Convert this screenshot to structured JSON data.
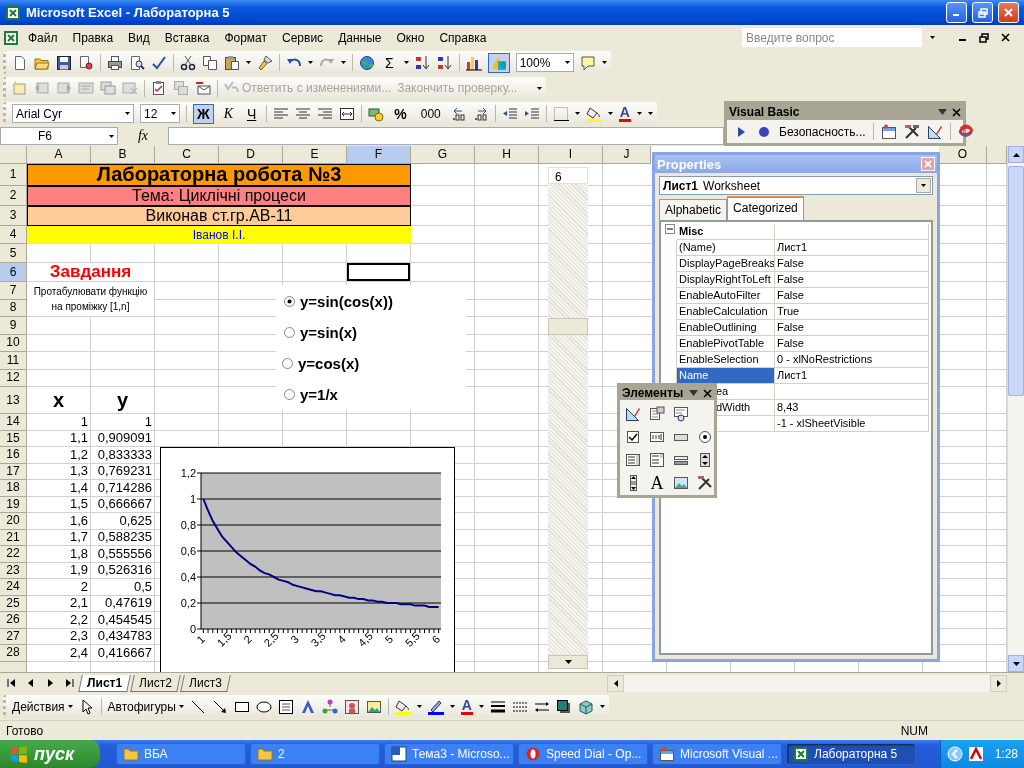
{
  "window": {
    "title": "Microsoft Excel - Лабораторна 5"
  },
  "menu": [
    "Файл",
    "Правка",
    "Вид",
    "Вставка",
    "Формат",
    "Сервис",
    "Данные",
    "Окно",
    "Справка"
  ],
  "help_box": {
    "placeholder": "Введите вопрос"
  },
  "standard_toolbar": {
    "sum_glyph": "Σ",
    "zoom": "100%",
    "drawing_on": true
  },
  "review_toolbar": {
    "actions": [
      {
        "label": "Ответить с изменениями...",
        "disabled": true
      },
      {
        "label": "Закончить проверку...",
        "disabled": true
      }
    ]
  },
  "format_toolbar": {
    "font": "Arial Cyr",
    "size": "12",
    "styles": [
      {
        "label": "Ж",
        "selected": true
      },
      {
        "label": "К",
        "selected": false
      },
      {
        "label": "Ч",
        "selected": false
      }
    ],
    "percent": "%",
    "thousands": "000",
    "font_color_glyph": "A"
  },
  "visual_basic_toolbar": {
    "title": "Visual Basic",
    "security": "Безопасность..."
  },
  "formula_bar": {
    "name_box": "F6",
    "fx": "fx"
  },
  "sheet": {
    "columns": [
      {
        "label": "A",
        "selected": false
      },
      {
        "label": "B",
        "selected": false
      },
      {
        "label": "C",
        "selected": false
      },
      {
        "label": "D",
        "selected": false
      },
      {
        "label": "E",
        "selected": false
      },
      {
        "label": "F",
        "selected": true
      },
      {
        "label": "G",
        "selected": false
      },
      {
        "label": "H",
        "selected": false
      },
      {
        "label": "I",
        "selected": false
      },
      {
        "label": "J",
        "selected": false
      },
      {
        "label": "O",
        "selected": false
      }
    ],
    "rows": [
      {
        "label": "1",
        "selected": false,
        "kind": "title",
        "cells": [
          "Лабораторна робота №3"
        ]
      },
      {
        "label": "2",
        "selected": false,
        "kind": "topic",
        "cells": [
          "Тема: Циклічні процеси"
        ]
      },
      {
        "label": "3",
        "selected": false,
        "kind": "author",
        "cells": [
          "Виконав ст.гр.АВ-11"
        ]
      },
      {
        "label": "4",
        "selected": false,
        "kind": "name",
        "cells": [
          "Іванов І.І."
        ]
      },
      {
        "label": "5",
        "selected": false,
        "kind": "blank"
      },
      {
        "label": "6",
        "selected": true,
        "kind": "task",
        "cells": [
          "Завдання"
        ]
      },
      {
        "label": "7",
        "selected": false,
        "kind": "note",
        "cells": [
          "Протабулювати функцію на проміжку [1,n]"
        ]
      },
      {
        "label": "8",
        "selected": false,
        "kind": "blank"
      },
      {
        "label": "9",
        "selected": false,
        "kind": "blank"
      },
      {
        "label": "10",
        "selected": false,
        "kind": "blank"
      },
      {
        "label": "11",
        "selected": false,
        "kind": "blank"
      },
      {
        "label": "12",
        "selected": false,
        "kind": "blank"
      },
      {
        "label": "13",
        "selected": false,
        "kind": "head",
        "cells": [
          "x",
          "y"
        ]
      },
      {
        "label": "14",
        "selected": false,
        "kind": "data",
        "cells": [
          "1",
          "1"
        ]
      },
      {
        "label": "15",
        "selected": false,
        "kind": "data",
        "cells": [
          "1,1",
          "0,909091"
        ]
      },
      {
        "label": "16",
        "selected": false,
        "kind": "data",
        "cells": [
          "1,2",
          "0,833333"
        ]
      },
      {
        "label": "17",
        "selected": false,
        "kind": "data",
        "cells": [
          "1,3",
          "0,769231"
        ]
      },
      {
        "label": "18",
        "selected": false,
        "kind": "data",
        "cells": [
          "1,4",
          "0,714286"
        ]
      },
      {
        "label": "19",
        "selected": false,
        "kind": "data",
        "cells": [
          "1,5",
          "0,666667"
        ]
      },
      {
        "label": "20",
        "selected": false,
        "kind": "data",
        "cells": [
          "1,6",
          "0,625"
        ]
      },
      {
        "label": "21",
        "selected": false,
        "kind": "data",
        "cells": [
          "1,7",
          "0,588235"
        ]
      },
      {
        "label": "22",
        "selected": false,
        "kind": "data",
        "cells": [
          "1,8",
          "0,555556"
        ]
      },
      {
        "label": "23",
        "selected": false,
        "kind": "data",
        "cells": [
          "1,9",
          "0,526316"
        ]
      },
      {
        "label": "24",
        "selected": false,
        "kind": "data",
        "cells": [
          "2",
          "0,5"
        ]
      },
      {
        "label": "25",
        "selected": false,
        "kind": "data",
        "cells": [
          "2,1",
          "0,47619"
        ]
      },
      {
        "label": "26",
        "selected": false,
        "kind": "data",
        "cells": [
          "2,2",
          "0,454545"
        ]
      },
      {
        "label": "27",
        "selected": false,
        "kind": "data",
        "cells": [
          "2,3",
          "0,434783"
        ]
      },
      {
        "label": "28",
        "selected": false,
        "kind": "data",
        "cells": [
          "2,4",
          "0,416667"
        ]
      }
    ],
    "options": [
      {
        "label": "y=sin(cos(x))",
        "selected": true
      },
      {
        "label": "y=sin(x)",
        "selected": false
      },
      {
        "label": "y=cos(x)",
        "selected": false
      },
      {
        "label": "y=1/x",
        "selected": false
      }
    ],
    "scroll_control": {
      "value": "6"
    },
    "chart": {
      "chart_data": {
        "type": "line",
        "x": [
          1,
          1.1,
          1.2,
          1.3,
          1.4,
          1.5,
          1.6,
          1.7,
          1.8,
          1.9,
          2,
          2.1,
          2.2,
          2.3,
          2.4,
          2.5,
          2.6,
          2.7,
          2.8,
          2.9,
          3,
          3.1,
          3.2,
          3.3,
          3.4,
          3.5,
          3.6,
          3.7,
          3.8,
          3.9,
          4,
          4.1,
          4.2,
          4.3,
          4.4,
          4.5,
          4.6,
          4.7,
          4.8,
          4.9,
          5,
          5.1,
          5.2,
          5.3,
          5.4,
          5.5,
          5.6,
          5.7,
          5.8,
          5.9,
          6
        ],
        "series": [
          {
            "color": "#000080",
            "values": [
              1,
              0.91,
              0.83,
              0.77,
              0.71,
              0.67,
              0.63,
              0.59,
              0.56,
              0.53,
              0.5,
              0.48,
              0.45,
              0.43,
              0.42,
              0.4,
              0.38,
              0.37,
              0.36,
              0.34,
              0.33,
              0.32,
              0.31,
              0.3,
              0.29,
              0.29,
              0.28,
              0.27,
              0.26,
              0.26,
              0.25,
              0.24,
              0.24,
              0.23,
              0.23,
              0.22,
              0.22,
              0.21,
              0.21,
              0.2,
              0.2,
              0.2,
              0.19,
              0.19,
              0.19,
              0.18,
              0.18,
              0.18,
              0.17,
              0.17,
              0.17
            ]
          }
        ],
        "xlim": [
          0.95,
          6.05
        ],
        "ylim": [
          0,
          1.2
        ],
        "grid": true,
        "yticks": [
          {
            "value": 0,
            "label": "0"
          },
          {
            "value": 0.2,
            "label": "0,2"
          },
          {
            "value": 0.4,
            "label": "0,4"
          },
          {
            "value": 0.6,
            "label": "0,6"
          },
          {
            "value": 0.8,
            "label": "0,8"
          },
          {
            "value": 1,
            "label": "1"
          },
          {
            "value": 1.2,
            "label": "1,2"
          }
        ],
        "xticks": [
          {
            "value": 1,
            "label": "1"
          },
          {
            "value": 1.5,
            "label": "1,5"
          },
          {
            "value": 2,
            "label": "2"
          },
          {
            "value": 2.5,
            "label": "2,5"
          },
          {
            "value": 3,
            "label": "3"
          },
          {
            "value": 3.5,
            "label": "3,5"
          },
          {
            "value": 4,
            "label": "4"
          },
          {
            "value": 4.5,
            "label": "4,5"
          },
          {
            "value": 5,
            "label": "5"
          },
          {
            "value": 5.5,
            "label": "5,5"
          },
          {
            "value": 6,
            "label": "6"
          }
        ]
      }
    }
  },
  "properties": {
    "title": "Properties",
    "object": {
      "name": "Лист1",
      "type": "Worksheet"
    },
    "tabs": [
      {
        "label": "Alphabetic",
        "selected": false
      },
      {
        "label": "Categorized",
        "selected": true
      }
    ],
    "category": {
      "label": "Misc",
      "expanded": true
    },
    "items": [
      {
        "name": "(Name)",
        "value": "Лист1",
        "selected": false
      },
      {
        "name": "DisplayPageBreaks",
        "value": "False",
        "selected": false
      },
      {
        "name": "DisplayRightToLeft",
        "value": "False",
        "selected": false
      },
      {
        "name": "EnableAutoFilter",
        "value": "False",
        "selected": false
      },
      {
        "name": "EnableCalculation",
        "value": "True",
        "selected": false
      },
      {
        "name": "EnableOutlining",
        "value": "False",
        "selected": false
      },
      {
        "name": "EnablePivotTable",
        "value": "False",
        "selected": false
      },
      {
        "name": "EnableSelection",
        "value": "0 - xlNoRestrictions",
        "selected": false
      },
      {
        "name": "Name",
        "value": "Лист1",
        "selected": true
      },
      {
        "name": "ea",
        "selected": false,
        "kind": "partial"
      },
      {
        "name": "dWidth",
        "value": "8,43",
        "selected": false,
        "kind": "partial"
      },
      {
        "value": "-1 - xlSheetVisible",
        "selected": false,
        "kind": "hidden"
      }
    ]
  },
  "controls_toolbar": {
    "title": "Элементы",
    "label_glyph": "A"
  },
  "sheet_tabs": [
    {
      "label": "Лист1",
      "selected": true
    },
    {
      "label": "Лист2",
      "selected": false
    },
    {
      "label": "Лист3",
      "selected": false
    }
  ],
  "drawing_toolbar": {
    "actions": "Действия",
    "autoshapes": "Автофигуры",
    "font_color_glyph": "A"
  },
  "status_bar": {
    "status": "Готово",
    "indicator": "NUM"
  },
  "taskbar": {
    "start": "пуск",
    "tasks": [
      {
        "label": "ВБА",
        "selected": false,
        "kind": "folder"
      },
      {
        "label": "2",
        "selected": false,
        "kind": "folder"
      },
      {
        "label": "Тема3 - Microso...",
        "selected": false,
        "kind": "word"
      },
      {
        "label": "Speed Dial - Op...",
        "selected": false,
        "kind": "browser"
      },
      {
        "label": "Microsoft Visual ...",
        "selected": false,
        "kind": "vba"
      },
      {
        "label": "Лабораторна 5",
        "selected": true,
        "kind": "excel"
      }
    ],
    "clock": "1:28"
  }
}
